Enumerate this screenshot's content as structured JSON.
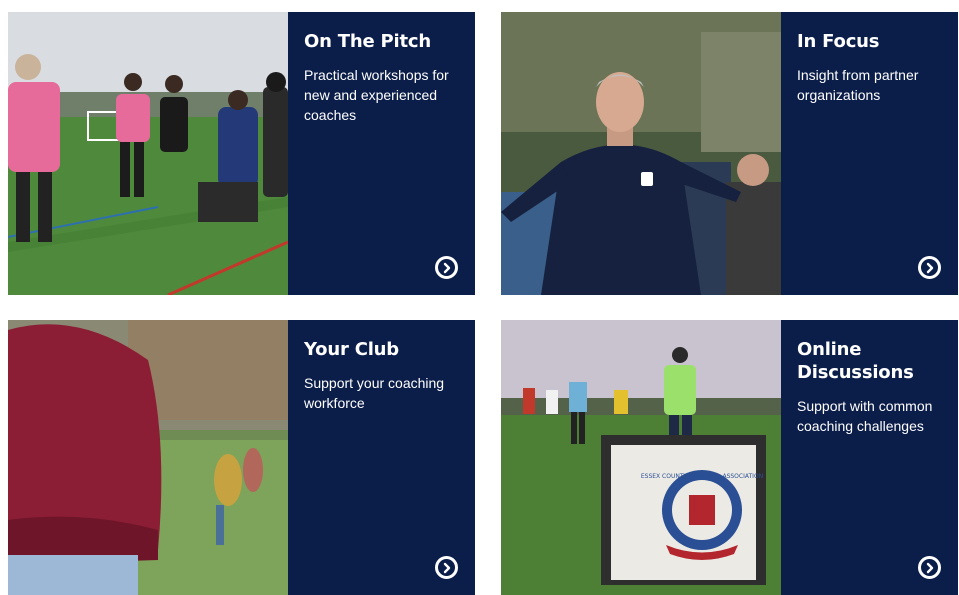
{
  "cards": [
    {
      "title": "On The Pitch",
      "description": "Practical workshops for new and experienced coaches",
      "link_icon": "chevron-right-circle-icon",
      "image": "coaches-on-pitch-photo"
    },
    {
      "title": "In Focus",
      "description": "Insight from partner organizations",
      "link_icon": "chevron-right-circle-icon",
      "image": "coach-speaking-photo"
    },
    {
      "title": "Your Club",
      "description": "Support your coaching workforce",
      "link_icon": "chevron-right-circle-icon",
      "image": "club-players-photo"
    },
    {
      "title": "Online Discussions",
      "description": "Support with common coaching challenges",
      "link_icon": "chevron-right-circle-icon",
      "image": "training-session-photo",
      "badge_text": "ESSEX COUNTY FOOTBALL ASSOCIATION"
    }
  ],
  "colors": {
    "panel_bg": "#0b1d49",
    "text": "#ffffff"
  }
}
